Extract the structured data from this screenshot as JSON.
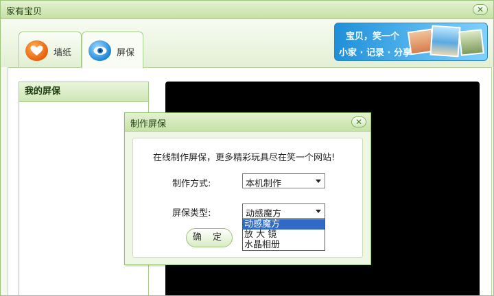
{
  "window": {
    "title": "家有宝贝"
  },
  "tabs": [
    {
      "label": "墙纸",
      "icon": "heart-icon",
      "selected": false
    },
    {
      "label": "屏保",
      "icon": "eye-icon",
      "selected": true
    }
  ],
  "banner": {
    "line1": "宝贝，笑一个",
    "line2": "小家 · 记录 · 分享"
  },
  "panel": {
    "title": "我的屏保"
  },
  "dialog": {
    "title": "制作屏保",
    "message": "在线制作屏保，更多精彩玩具尽在笑一个网站!",
    "method_label": "制作方式:",
    "method_value": "本机制作",
    "type_label": "屏保类型:",
    "type_value": "动感魔方",
    "type_options": [
      "动感魔方",
      "放 大 镜",
      "水晶相册"
    ],
    "ok_label": "确 定"
  },
  "colors": {
    "accent": "#c5e1a5",
    "preview_bg": "#000000",
    "selection": "#3169c6"
  }
}
